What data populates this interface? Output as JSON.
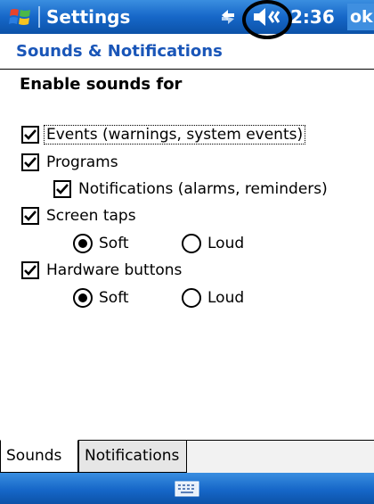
{
  "titlebar": {
    "title": "Settings",
    "clock": "2:36",
    "ok_label": "ok",
    "icons": [
      "windows-start-icon",
      "connectivity-icon",
      "volume-muted-icon"
    ]
  },
  "page": {
    "header": "Sounds & Notifications",
    "section_title": "Enable sounds for"
  },
  "options": {
    "events": {
      "label": "Events (warnings, system events)",
      "checked": true
    },
    "programs": {
      "label": "Programs",
      "checked": true
    },
    "notifications": {
      "label": "Notifications (alarms, reminders)",
      "checked": true
    },
    "screen_taps": {
      "label": "Screen taps",
      "checked": true,
      "selected": "Soft",
      "soft_label": "Soft",
      "loud_label": "Loud"
    },
    "hardware_buttons": {
      "label": "Hardware buttons",
      "checked": true,
      "selected": "Soft",
      "soft_label": "Soft",
      "loud_label": "Loud"
    }
  },
  "tabs": [
    {
      "label": "Sounds",
      "active": true
    },
    {
      "label": "Notifications",
      "active": false
    }
  ],
  "menubar": {
    "icon": "keyboard-icon"
  },
  "colors": {
    "titlebar": "#1667c8",
    "header_text": "#1a56b8",
    "annotation_ring": "#000000"
  }
}
